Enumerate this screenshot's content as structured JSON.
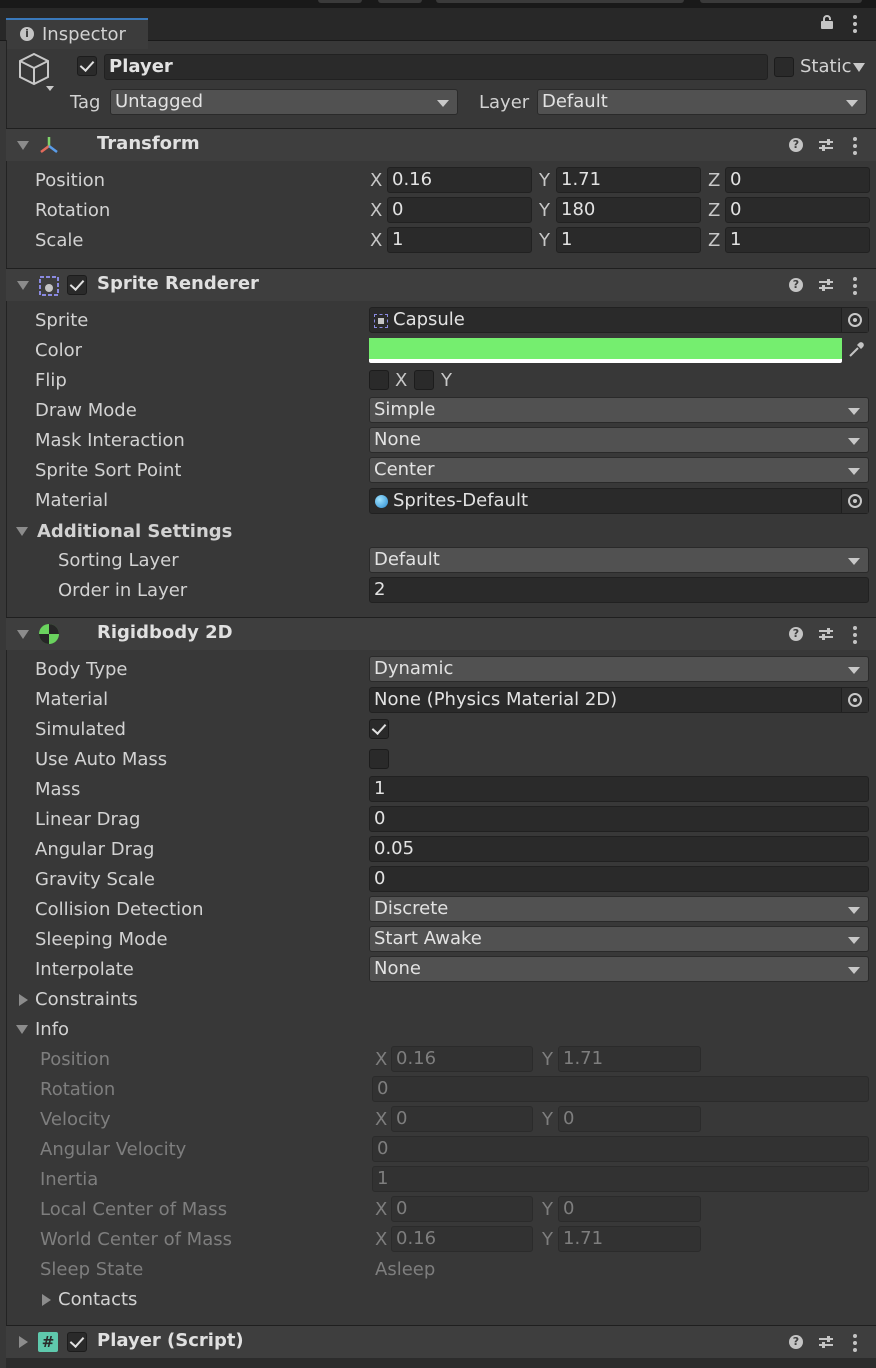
{
  "tab": {
    "label": "Inspector"
  },
  "object": {
    "name": "Player",
    "active": true,
    "static_label": "Static",
    "tag_label": "Tag",
    "tag_value": "Untagged",
    "layer_label": "Layer",
    "layer_value": "Default"
  },
  "transform": {
    "title": "Transform",
    "rows": [
      {
        "label": "Position",
        "x": "0.16",
        "y": "1.71",
        "z": "0"
      },
      {
        "label": "Rotation",
        "x": "0",
        "y": "180",
        "z": "0"
      },
      {
        "label": "Scale",
        "x": "1",
        "y": "1",
        "z": "1"
      }
    ]
  },
  "axis": {
    "x": "X",
    "y": "Y",
    "z": "Z"
  },
  "sprite_renderer": {
    "title": "Sprite Renderer",
    "enabled": true,
    "sprite_label": "Sprite",
    "sprite_value": "Capsule",
    "color_label": "Color",
    "color_value": "#75ee6f",
    "flip_label": "Flip",
    "flip_x": "X",
    "flip_y": "Y",
    "draw_mode_label": "Draw Mode",
    "draw_mode_value": "Simple",
    "mask_label": "Mask Interaction",
    "mask_value": "None",
    "sort_point_label": "Sprite Sort Point",
    "sort_point_value": "Center",
    "material_label": "Material",
    "material_value": "Sprites-Default",
    "additional_label": "Additional Settings",
    "sorting_layer_label": "Sorting Layer",
    "sorting_layer_value": "Default",
    "order_label": "Order in Layer",
    "order_value": "2"
  },
  "rigidbody": {
    "title": "Rigidbody 2D",
    "body_type_label": "Body Type",
    "body_type_value": "Dynamic",
    "material_label": "Material",
    "material_value": "None (Physics Material 2D)",
    "simulated_label": "Simulated",
    "simulated": true,
    "auto_mass_label": "Use Auto Mass",
    "auto_mass": false,
    "mass_label": "Mass",
    "mass_value": "1",
    "linear_drag_label": "Linear Drag",
    "linear_drag_value": "0",
    "angular_drag_label": "Angular Drag",
    "angular_drag_value": "0.05",
    "gravity_label": "Gravity Scale",
    "gravity_value": "0",
    "collision_label": "Collision Detection",
    "collision_value": "Discrete",
    "sleeping_label": "Sleeping Mode",
    "sleeping_value": "Start Awake",
    "interpolate_label": "Interpolate",
    "interpolate_value": "None",
    "constraints_label": "Constraints",
    "info_label": "Info",
    "info": {
      "position_label": "Position",
      "position_x": "0.16",
      "position_y": "1.71",
      "rotation_label": "Rotation",
      "rotation_value": "0",
      "velocity_label": "Velocity",
      "velocity_x": "0",
      "velocity_y": "0",
      "angular_velocity_label": "Angular Velocity",
      "angular_velocity_value": "0",
      "inertia_label": "Inertia",
      "inertia_value": "1",
      "local_com_label": "Local Center of Mass",
      "local_com_x": "0",
      "local_com_y": "0",
      "world_com_label": "World Center of Mass",
      "world_com_x": "0.16",
      "world_com_y": "1.71",
      "sleep_state_label": "Sleep State",
      "sleep_state_value": "Asleep",
      "contacts_label": "Contacts"
    }
  },
  "player_script": {
    "title": "Player (Script)",
    "enabled": true
  },
  "icons": [
    "info-icon",
    "lock-icon",
    "kebab-menu-icon",
    "gameobject-cube-icon",
    "transform-axes-icon",
    "sprite-renderer-icon",
    "rigidbody-icon",
    "script-icon",
    "help-icon",
    "presets-icon",
    "object-picker-icon",
    "eyedropper-icon",
    "sprite-asset-icon",
    "material-sphere-icon"
  ]
}
